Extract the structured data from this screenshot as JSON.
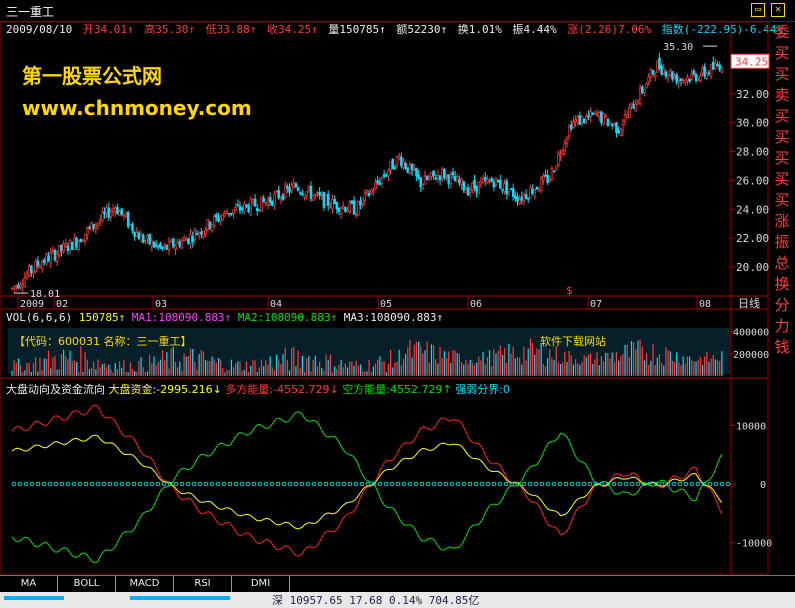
{
  "header": {
    "stock_name": "三一重工",
    "date": "2009/08/10",
    "open": "开34.01↑",
    "high": "高35.30↑",
    "low": "低33.88↑",
    "close": "收34.25↑",
    "volume": "量150785↑",
    "amount": "额52230↑",
    "turnover": "换1.01%",
    "amplitude": "振4.44%",
    "change": "涨(2.26)7.06%",
    "index": "指数(-222.95)-6.44%"
  },
  "watermark": {
    "line1": "第一股票公式网",
    "line2": "www.chnmoney.com"
  },
  "price_chart": {
    "high_label": "35.30",
    "low_label": "18.01",
    "current_price": "34.25",
    "y_ticks": [
      "32.00",
      "30.00",
      "28.00",
      "26.00",
      "24.00",
      "22.00",
      "20.00"
    ],
    "x_ticks": [
      "2009",
      "02",
      "03",
      "04",
      "05",
      "06",
      "07",
      "08"
    ],
    "period_label": "日线",
    "marker": "$"
  },
  "volume_panel": {
    "label": "VOL(6,6,6)",
    "vol": "150785↑",
    "ma1": "MA1:108090.883↑",
    "ma2": "MA2:108090.883↑",
    "ma3": "MA3:108090.883↑",
    "y_ticks": [
      "400000",
      "200000"
    ],
    "banner_left": "【代码：600031  名称：三一重工】",
    "banner_right": "软件下载网站"
  },
  "fund_panel": {
    "title": "大盘动向及资金流向",
    "big_fund": "大盘资金:-2995.216↓",
    "bull_energy": "多方能量:-4552.729↓",
    "bear_energy": "空方能量:4552.729↑",
    "threshold": "强弱分界:0",
    "y_ticks": [
      "10000",
      "0",
      "-10000"
    ]
  },
  "tabs": [
    "MA",
    "BOLL",
    "MACD",
    "RSI",
    "DMI"
  ],
  "status": {
    "text": "深 10957.65  17.68  0.14%  704.85亿"
  },
  "side_strip": [
    "委",
    "买",
    "买",
    "卖",
    "买",
    "买",
    "买",
    "买",
    "买",
    "涨",
    "振",
    "总",
    "换",
    "分",
    "力",
    "钱"
  ],
  "colors": {
    "up": "#ff3b3b",
    "down": "#00e0ff",
    "ma_yellow": "#ffff00",
    "bull": "#ff2020",
    "bear": "#00e000",
    "zero_line": "#00c8c8"
  },
  "chart_data": [
    {
      "type": "candlestick",
      "title": "三一重工",
      "x": [
        "2009/01",
        "2009/02",
        "2009/03",
        "2009/04",
        "2009/05",
        "2009/06",
        "2009/07",
        "2009/08"
      ],
      "close_approx": [
        19.5,
        22.0,
        22.5,
        24.0,
        27.5,
        25.0,
        31.0,
        34.25
      ],
      "ylim": [
        18,
        36
      ]
    },
    {
      "type": "bar",
      "title": "VOL(6,6,6)",
      "ylim": [
        0,
        450000
      ]
    },
    {
      "type": "line",
      "title": "大盘动向及资金流向",
      "ylim": [
        -15000,
        15000
      ],
      "series": [
        {
          "name": "大盘资金",
          "last": -2995.216
        },
        {
          "name": "多方能量",
          "last": -4552.729
        },
        {
          "name": "空方能量",
          "last": 4552.729
        },
        {
          "name": "强弱分界",
          "last": 0
        }
      ]
    }
  ]
}
